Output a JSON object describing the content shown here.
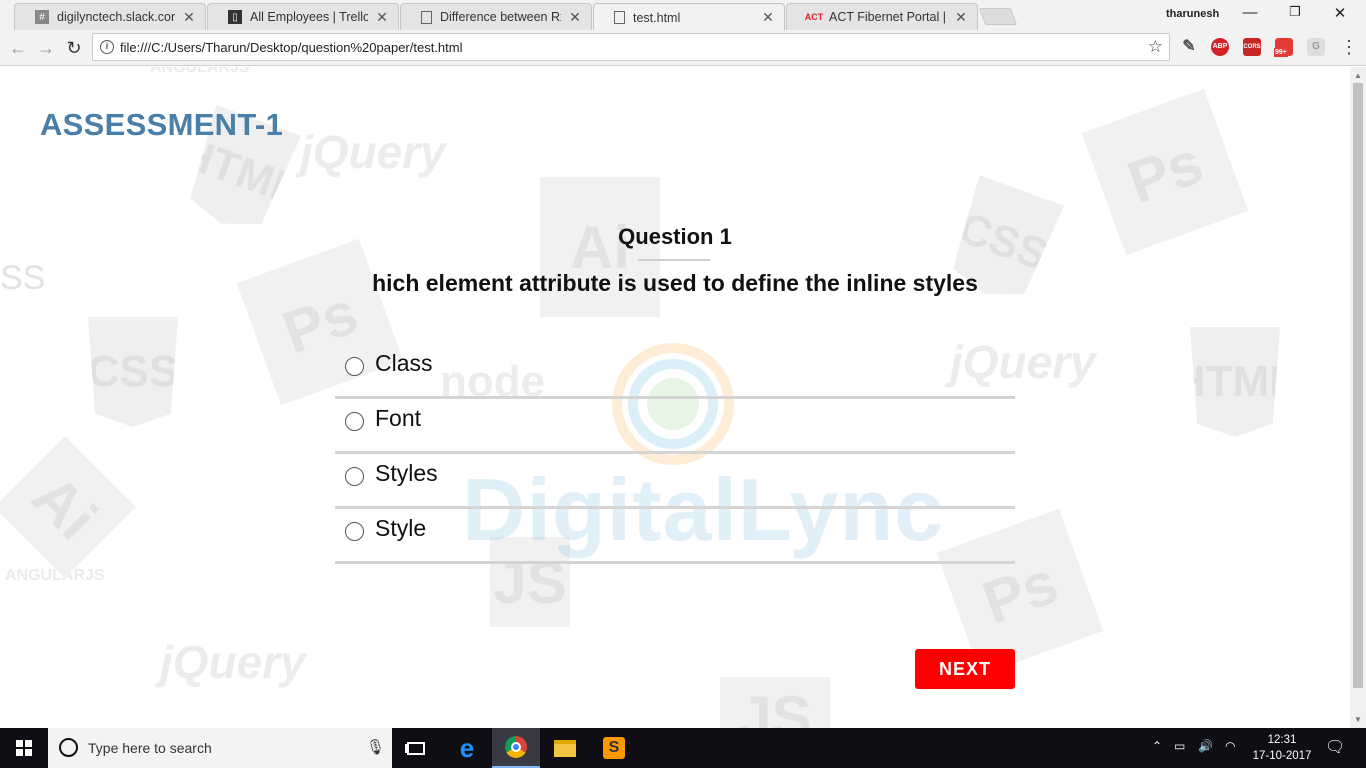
{
  "browser": {
    "tabs": [
      {
        "title": "digilynctech.slack.com",
        "icon": "slack-icon"
      },
      {
        "title": "All Employees | Trello",
        "icon": "trello-icon"
      },
      {
        "title": "Difference between Rxjs",
        "icon": "page-icon"
      },
      {
        "title": "test.html",
        "icon": "page-icon",
        "active": true
      },
      {
        "title": "ACT Fibernet Portal | ACT",
        "icon": "act-icon"
      }
    ],
    "profile": "tharunesh",
    "url": "file:///C:/Users/Tharun/Desktop/question%20paper/test.html",
    "extensions": [
      {
        "name": "eyedropper-icon",
        "label": ""
      },
      {
        "name": "adblock-plus-icon",
        "label": "ABP"
      },
      {
        "name": "cors-icon",
        "label": "CORS"
      },
      {
        "name": "notification-icon",
        "label": "99+"
      },
      {
        "name": "google-icon",
        "label": "G"
      }
    ]
  },
  "page": {
    "title": "ASSESSMENT-1",
    "question_number": "Question 1",
    "question_text": "hich element attribute is used to define the inline styles",
    "options": [
      "Class",
      "Font",
      "Styles",
      "Style"
    ],
    "next_label": "NEXT",
    "watermark_brand": "DigitalLync",
    "watermark_words": [
      "jQuery",
      "jQuery",
      "jQuery",
      "node",
      "ANGULARJS",
      "ANGULARJS",
      "HTML",
      "CSS",
      "CSS",
      "HTML",
      "Ps",
      "Ps",
      "Ps",
      "Ai",
      "Ai",
      "JS",
      "JS",
      "SS"
    ]
  },
  "taskbar": {
    "search_placeholder": "Type here to search",
    "time": "12:31",
    "date": "17-10-2017"
  },
  "colors": {
    "title": "#4a7fa8",
    "next_button": "#ff0000"
  }
}
